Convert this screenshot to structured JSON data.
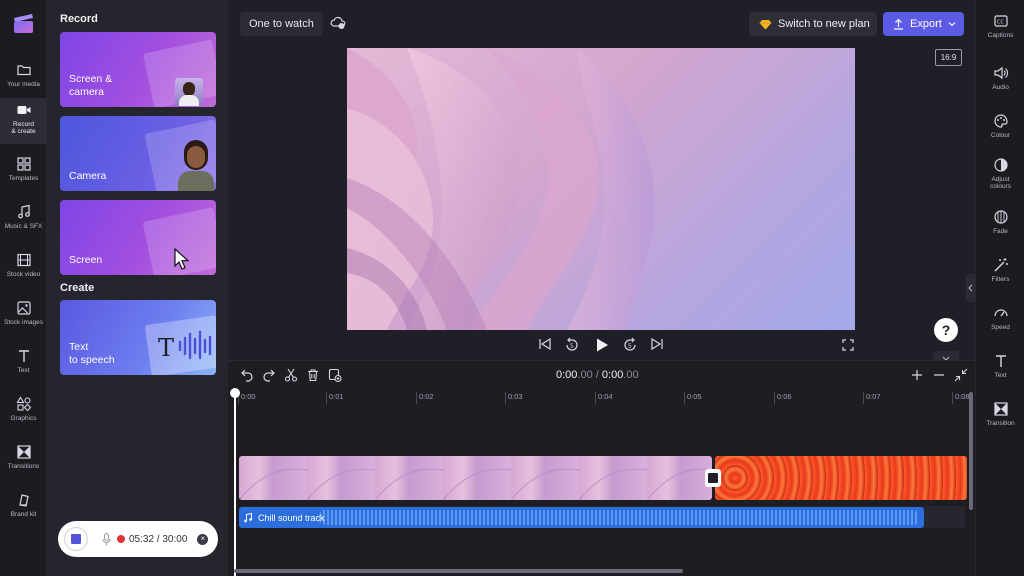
{
  "left_rail": {
    "items": [
      {
        "label": "Your media",
        "icon": "folder-icon"
      },
      {
        "label": "Record & create",
        "icon": "camera-icon"
      },
      {
        "label": "Templates",
        "icon": "templates-icon"
      },
      {
        "label": "Music & SFX",
        "icon": "music-icon"
      },
      {
        "label": "Stock video",
        "icon": "film-icon"
      },
      {
        "label": "Stock images",
        "icon": "image-icon"
      },
      {
        "label": "Text",
        "icon": "text-icon"
      },
      {
        "label": "Graphics",
        "icon": "shapes-icon"
      },
      {
        "label": "Transitions",
        "icon": "transitions-icon"
      },
      {
        "label": "Brand kit",
        "icon": "brand-kit-icon"
      }
    ],
    "active": "Record & create"
  },
  "panel": {
    "record_heading": "Record",
    "create_heading": "Create",
    "cards": [
      {
        "label_line1": "Screen &",
        "label_line2": "camera"
      },
      {
        "label_line1": "",
        "label_line2": "Camera"
      },
      {
        "label_line1": "",
        "label_line2": "Screen"
      },
      {
        "label_line1": "Text",
        "label_line2": "to speech"
      }
    ]
  },
  "recorder": {
    "time": "05:32 / 30:00"
  },
  "topbar": {
    "project_name": "One to watch",
    "plan_button": "Switch to new plan",
    "export_button": "Export"
  },
  "preview": {
    "aspect_ratio": "16:9"
  },
  "timeline": {
    "current_time_main": "0:00",
    "current_time_frac": ".00",
    "separator": "/",
    "total_time_main": "0:00",
    "total_time_frac": ".00",
    "ruler": [
      "0:00",
      "0:01",
      "0:02",
      "0:03",
      "0:04",
      "0:05",
      "0:06",
      "0:07",
      "0:08"
    ],
    "audio_track_name": "Chill sound track"
  },
  "right_rail": {
    "items": [
      {
        "label": "Captions",
        "icon": "captions-icon"
      },
      {
        "label": "Audio",
        "icon": "speaker-icon"
      },
      {
        "label": "Colour",
        "icon": "palette-icon"
      },
      {
        "label": "Adjust colours",
        "icon": "adjust-icon"
      },
      {
        "label": "Fade",
        "icon": "fade-icon"
      },
      {
        "label": "Filters",
        "icon": "magic-wand-icon"
      },
      {
        "label": "Speed",
        "icon": "speedometer-icon"
      },
      {
        "label": "Text",
        "icon": "text-icon"
      },
      {
        "label": "Transition",
        "icon": "transitions-icon"
      }
    ]
  },
  "help": {
    "label": "?"
  },
  "colors": {
    "accent": "#5b5be6",
    "audio_track": "#2c6fdc",
    "record_dot": "#e0323c"
  }
}
